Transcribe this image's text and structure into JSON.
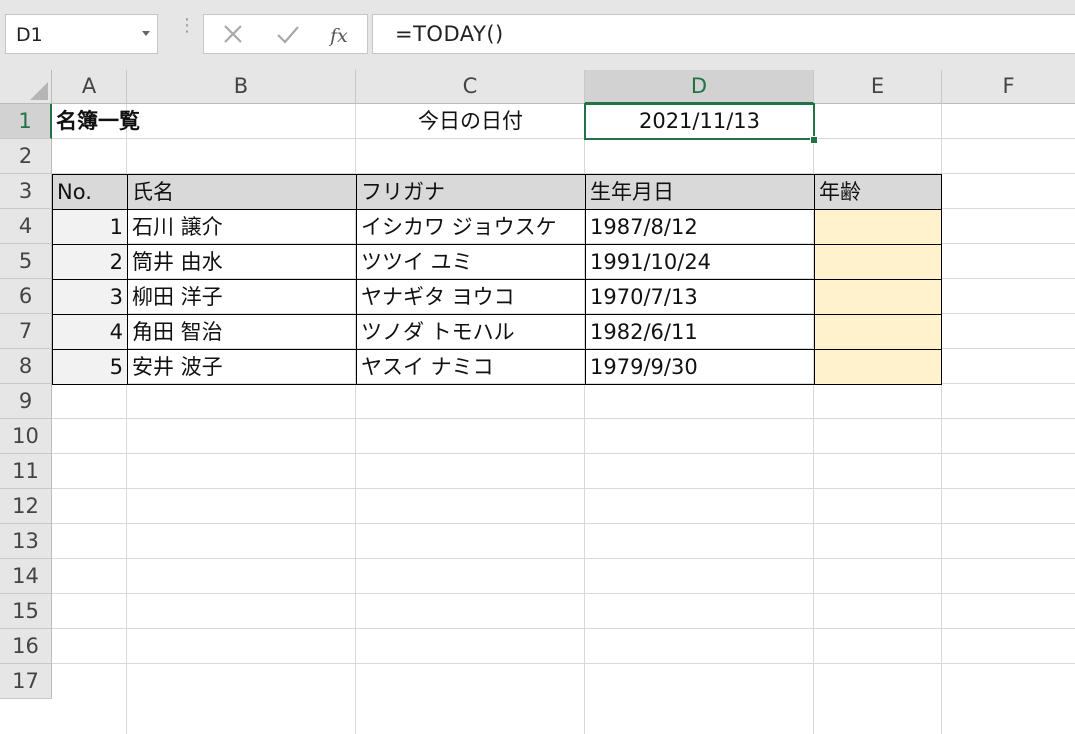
{
  "formula_bar": {
    "name_box": "D1",
    "formula": "=TODAY()",
    "cancel_icon": "close-icon",
    "enter_icon": "check-icon",
    "function_icon": "fx-icon"
  },
  "columns": [
    "A",
    "B",
    "C",
    "D",
    "E",
    "F"
  ],
  "rows": [
    "1",
    "2",
    "3",
    "4",
    "5",
    "6",
    "7",
    "8",
    "9",
    "10",
    "11",
    "12",
    "13",
    "14",
    "15",
    "16",
    "17"
  ],
  "selected_cell": "D1",
  "sheet": {
    "title": "名簿一覧",
    "today_label": "今日の日付",
    "today_value": "2021/11/13",
    "headers": [
      "No.",
      "氏名",
      "フリガナ",
      "生年月日",
      "年齢"
    ],
    "records": [
      {
        "no": "1",
        "name": "石川 譲介",
        "kana": "イシカワ ジョウスケ",
        "birth": "1987/8/12",
        "age": ""
      },
      {
        "no": "2",
        "name": "筒井 由水",
        "kana": "ツツイ ユミ",
        "birth": "1991/10/24",
        "age": ""
      },
      {
        "no": "3",
        "name": "柳田 洋子",
        "kana": "ヤナギタ ヨウコ",
        "birth": "1970/7/13",
        "age": ""
      },
      {
        "no": "4",
        "name": "角田 智治",
        "kana": "ツノダ トモハル",
        "birth": "1982/6/11",
        "age": ""
      },
      {
        "no": "5",
        "name": "安井 波子",
        "kana": "ヤスイ ナミコ",
        "birth": "1979/9/30",
        "age": ""
      }
    ]
  },
  "colors": {
    "accent": "#217346",
    "header_fill": "#d9d9d9",
    "no_fill": "#f2f2f2",
    "age_fill": "#fff2cc"
  }
}
